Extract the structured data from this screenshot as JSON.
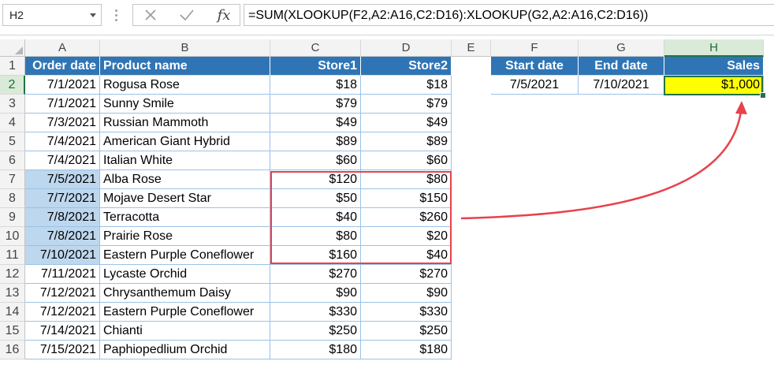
{
  "formula_bar": {
    "name_box": "H2",
    "cancel_icon": "close-icon",
    "enter_icon": "check-icon",
    "fx_label": "fx",
    "formula": "=SUM(XLOOKUP(F2,A2:A16,C2:D16):XLOOKUP(G2,A2:A16,C2:D16))"
  },
  "columns": [
    "A",
    "B",
    "C",
    "D",
    "E",
    "F",
    "G",
    "H"
  ],
  "selected_column": "H",
  "rows": [
    "1",
    "2",
    "3",
    "4",
    "5",
    "6",
    "7",
    "8",
    "9",
    "10",
    "11",
    "12",
    "13",
    "14",
    "15",
    "16"
  ],
  "selected_row": "2",
  "table": {
    "headers": [
      "Order date",
      "Product name",
      "Store1",
      "Store2"
    ],
    "data": [
      [
        "7/1/2021",
        "Rogusa Rose",
        "$18",
        "$18"
      ],
      [
        "7/1/2021",
        "Sunny Smile",
        "$79",
        "$79"
      ],
      [
        "7/3/2021",
        "Russian Mammoth",
        "$49",
        "$49"
      ],
      [
        "7/4/2021",
        "American Giant Hybrid",
        "$89",
        "$89"
      ],
      [
        "7/4/2021",
        "Italian White",
        "$60",
        "$60"
      ],
      [
        "7/5/2021",
        "Alba Rose",
        "$120",
        "$80"
      ],
      [
        "7/7/2021",
        "Mojave Desert Star",
        "$50",
        "$150"
      ],
      [
        "7/8/2021",
        "Terracotta",
        "$40",
        "$260"
      ],
      [
        "7/8/2021",
        "Prairie Rose",
        "$80",
        "$20"
      ],
      [
        "7/10/2021",
        "Eastern Purple Coneflower",
        "$160",
        "$40"
      ],
      [
        "7/11/2021",
        "Lycaste Orchid",
        "$270",
        "$270"
      ],
      [
        "7/12/2021",
        "Chrysanthemum Daisy",
        "$90",
        "$90"
      ],
      [
        "7/12/2021",
        "Eastern Purple Coneflower",
        "$330",
        "$330"
      ],
      [
        "7/14/2021",
        "Chianti",
        "$250",
        "$250"
      ],
      [
        "7/15/2021",
        "Paphiopedlium Orchid",
        "$180",
        "$180"
      ]
    ]
  },
  "lookup": {
    "headers": [
      "Start date",
      "End date",
      "Sales"
    ],
    "values": [
      "7/5/2021",
      "7/10/2021",
      "$1,000"
    ]
  },
  "colors": {
    "header_blue": "#2f75b5",
    "highlight_blue": "#bdd7ee",
    "result_yellow": "#ffff00",
    "annotation_red": "#e8414b",
    "selection_green": "#217346"
  }
}
